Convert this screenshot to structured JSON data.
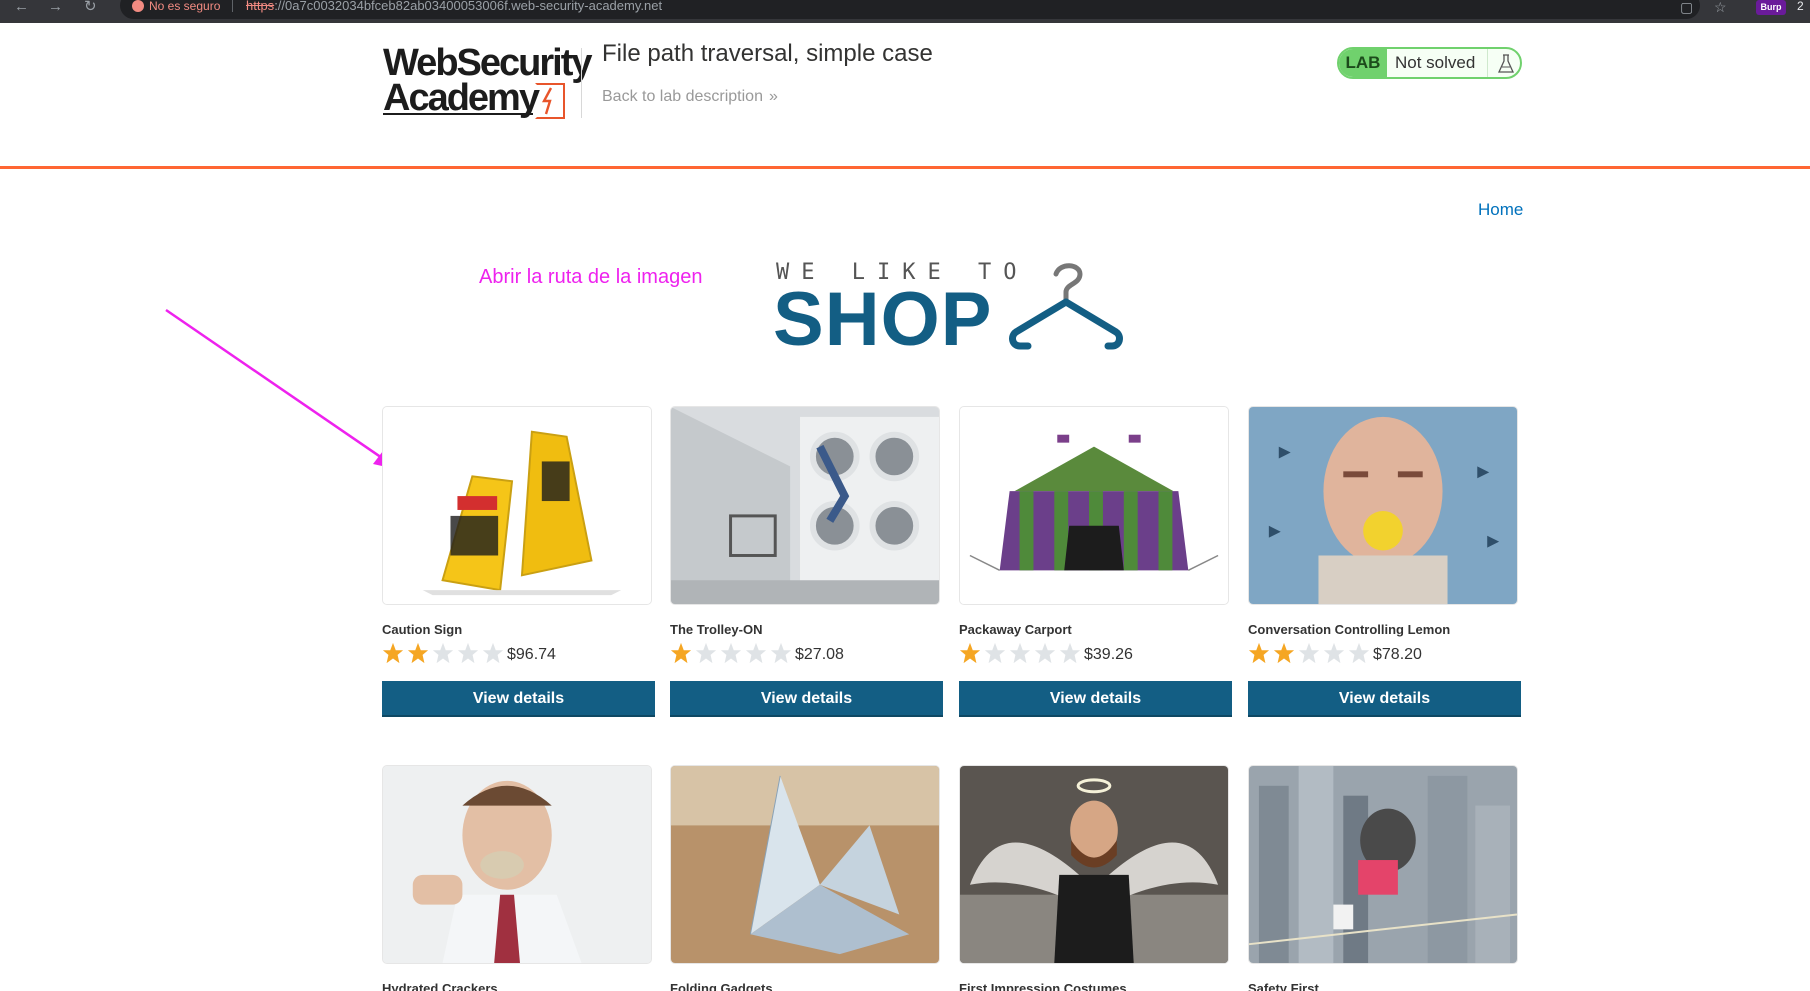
{
  "browser": {
    "security_label": "No es seguro",
    "url_scheme": "https",
    "url_rest": "://0a7c0032034bfceb82ab03400053006f.web-security-academy.net",
    "extension_label": "Burp",
    "profile_initial": "2"
  },
  "header": {
    "logo_line1": "WebSecurity",
    "logo_line2": "Academy",
    "lab_title": "File path traversal, simple case",
    "back_link": "Back to lab description",
    "lab_badge": "LAB",
    "lab_status": "Not solved",
    "accent_color": "#ff6633",
    "status_color": "#70d16d"
  },
  "nav": {
    "home": "Home"
  },
  "annotation": {
    "text": "Abrir la ruta de la imagen",
    "color": "#ee22ee"
  },
  "banner": {
    "tagline": "WE LIKE TO",
    "word": "SHOP",
    "color": "#135e84"
  },
  "button_label": "View details",
  "products": [
    {
      "name": "Caution Sign",
      "price": "$96.74",
      "rating": 2,
      "image_icon": "caution-sign-image"
    },
    {
      "name": "The Trolley-ON",
      "price": "$27.08",
      "rating": 1,
      "image_icon": "laundromat-image"
    },
    {
      "name": "Packaway Carport",
      "price": "$39.26",
      "rating": 1,
      "image_icon": "tent-image"
    },
    {
      "name": "Conversation Controlling Lemon",
      "price": "$78.20",
      "rating": 2,
      "image_icon": "lemon-man-image"
    },
    {
      "name": "Hydrated Crackers",
      "image_icon": "cracker-man-image"
    },
    {
      "name": "Folding Gadgets",
      "image_icon": "origami-image"
    },
    {
      "name": "First Impression Costumes",
      "image_icon": "angel-man-image"
    },
    {
      "name": "Safety First",
      "image_icon": "skyline-image"
    }
  ]
}
